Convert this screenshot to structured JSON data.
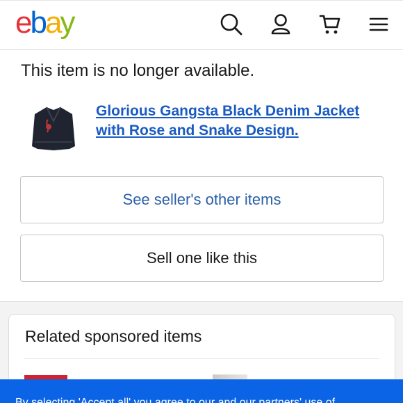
{
  "header": {
    "logo_letters": [
      {
        "ch": "e",
        "color": "#e53238"
      },
      {
        "ch": "b",
        "color": "#0064d2"
      },
      {
        "ch": "a",
        "color": "#f5af02"
      },
      {
        "ch": "y",
        "color": "#86b817"
      }
    ],
    "icons": [
      "search-icon",
      "account-icon",
      "cart-icon",
      "menu-icon"
    ]
  },
  "listing": {
    "status_text": "This item is no longer available.",
    "title_link": "Glorious Gangsta Black Denim Jacket with Rose and Snake Design.",
    "see_other_label": "See seller's other items",
    "sell_one_label": "Sell one like this"
  },
  "related": {
    "title": "Related sponsored items"
  },
  "consent": {
    "text": "By selecting 'Accept all' you agree to our and our partners' use of"
  },
  "colors": {
    "link": "#1a5bc2",
    "primary_button_text": "#2a5fa8",
    "consent_bg": "#0b64e6"
  }
}
